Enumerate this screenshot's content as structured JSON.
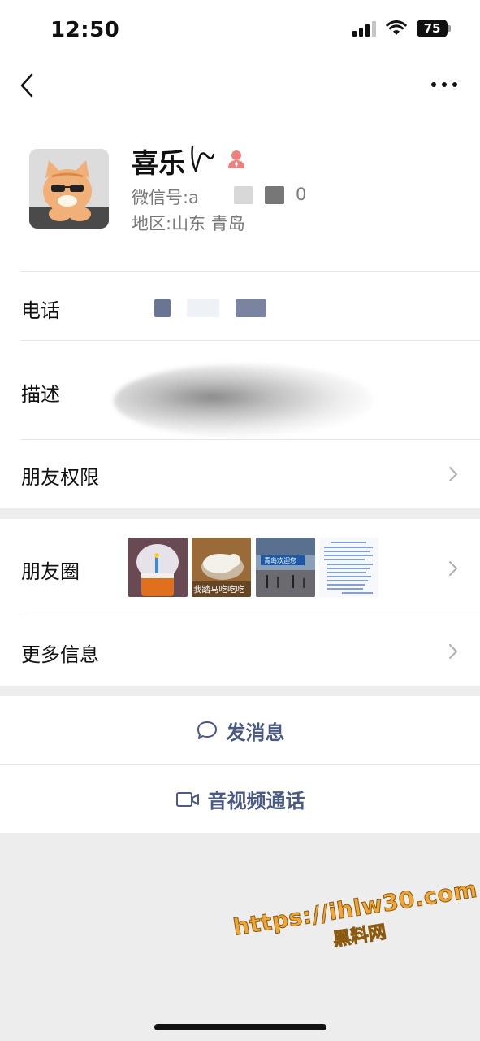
{
  "status_bar": {
    "time": "12:50",
    "battery": "75"
  },
  "profile": {
    "name": "喜乐",
    "wechat_id_label": "微信号:",
    "wechat_id_start": "a",
    "wechat_id_end": "0",
    "region_label": "地区:",
    "region": "山东 青岛"
  },
  "rows": {
    "phone_label": "电话",
    "description_label": "描述",
    "permissions_label": "朋友权限",
    "moments_label": "朋友圈",
    "more_info_label": "更多信息"
  },
  "moments": {
    "thumb2_caption": "我踏马吃吃吃",
    "thumb3_caption": "青岛欢迎您"
  },
  "actions": {
    "message": "发消息",
    "video_call": "音视频通话"
  },
  "watermark": {
    "url": "https://ihlw30.com",
    "site": "黑料网"
  },
  "colors": {
    "action_text": "#4a5a82",
    "background": "#ededed",
    "watermark": "#f0a634"
  }
}
